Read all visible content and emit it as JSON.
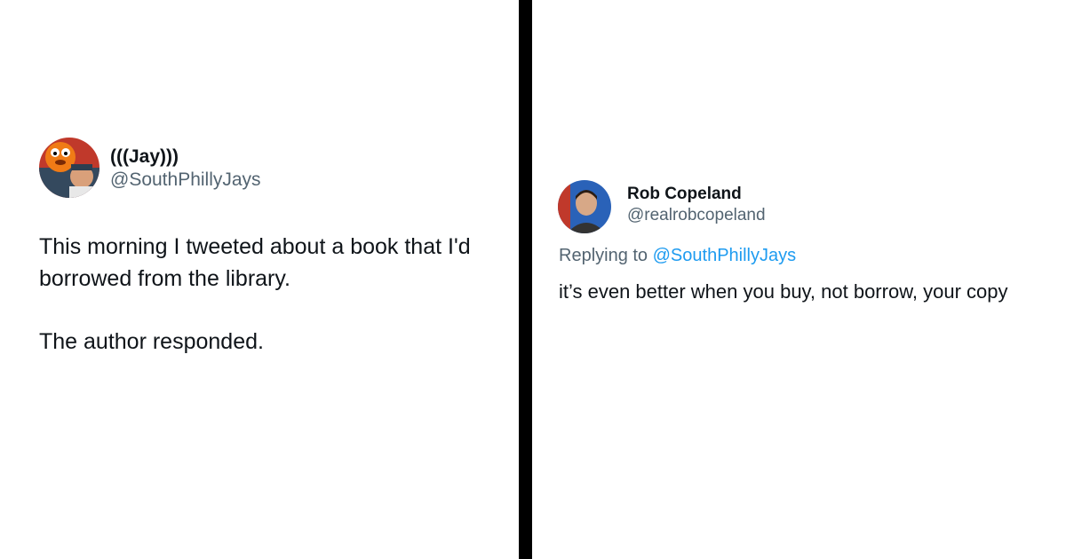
{
  "original_tweet": {
    "display_name": "(((Jay)))",
    "handle": "@SouthPhillyJays",
    "avatar": "mascot-avatar-icon",
    "text_lines": [
      "This morning I tweeted about a book that I'd borrowed from the library.",
      "The author responded."
    ]
  },
  "reply_tweet": {
    "display_name": "Rob Copeland",
    "handle": "@realrobcopeland",
    "avatar": "person-avatar-icon",
    "replying_to_label": "Replying to",
    "replying_to_handle": "@SouthPhillyJays",
    "text": "it’s even better when you buy, not borrow, your copy"
  },
  "colors": {
    "divider": "#000000",
    "primary_text": "#0f1419",
    "secondary_text": "#536471",
    "link": "#1d9bf0"
  }
}
